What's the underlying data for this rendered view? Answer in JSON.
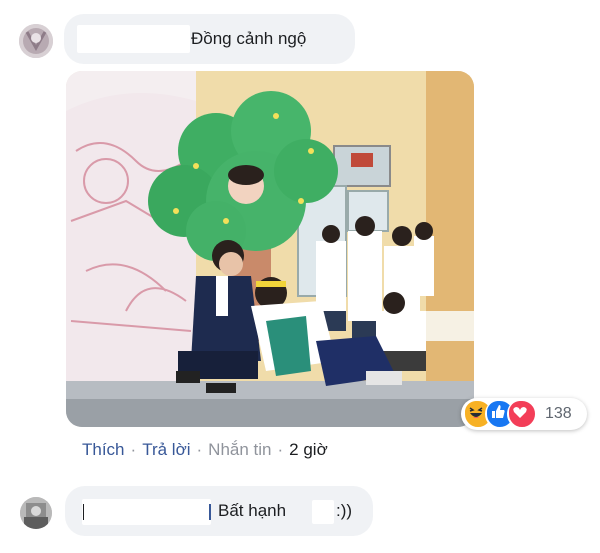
{
  "comment1": {
    "text": "Đồng cảnh ngộ"
  },
  "photo": {
    "description_icon": "image"
  },
  "actions": {
    "like": "Thích",
    "reply": "Trả lời",
    "message": "Nhắn tin",
    "time": "2 giờ",
    "separator": "·"
  },
  "reactions": {
    "icons": [
      "haha-icon",
      "like-icon",
      "love-icon"
    ],
    "count": "138"
  },
  "comment2": {
    "text": "Bất hạnh",
    "suffix": ":))"
  },
  "colors": {
    "link": "#385898",
    "muted": "#90949c",
    "bubble": "#f0f2f5",
    "like": "#1877f2",
    "love": "#f33e58",
    "haha": "#f7b125"
  }
}
